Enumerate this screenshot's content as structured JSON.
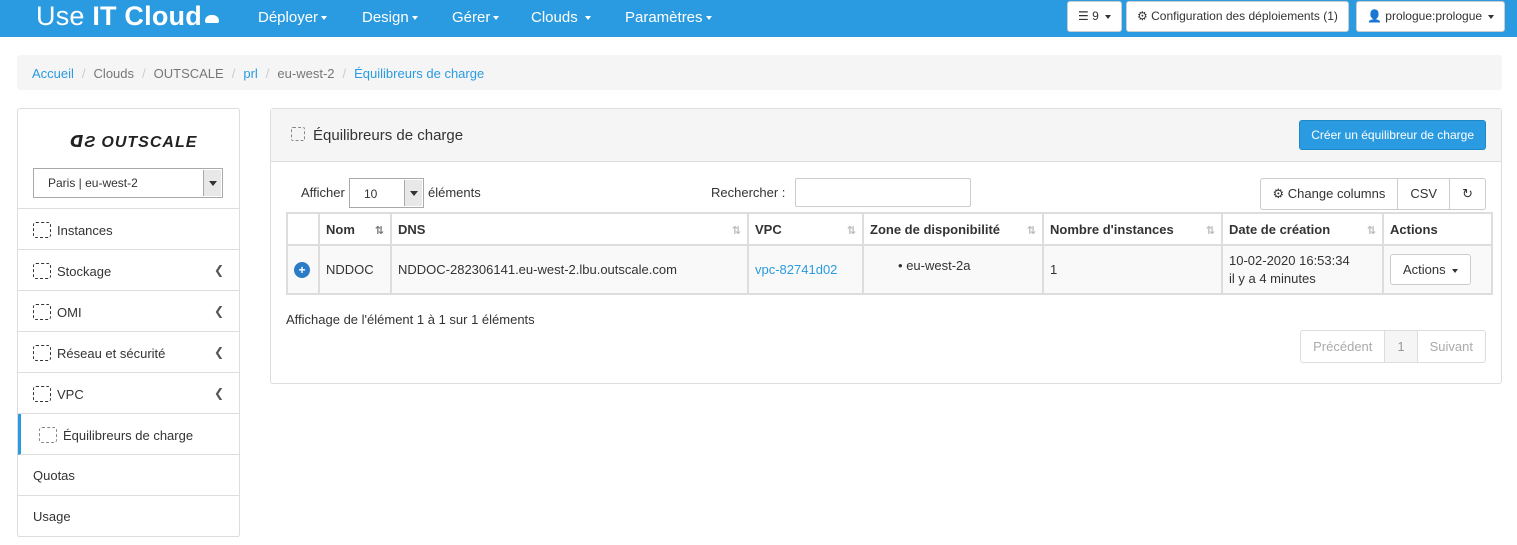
{
  "navbar": {
    "brand_use": "Use ",
    "brand_it": "IT Cloud",
    "menu": [
      {
        "label": "Déployer"
      },
      {
        "label": "Design"
      },
      {
        "label": "Gérer"
      },
      {
        "label": "Clouds"
      },
      {
        "label": "Paramètres"
      }
    ],
    "jobs_count": "9",
    "deploy_config": "Configuration des déploiements (1)",
    "user": "prologue:prologue"
  },
  "breadcrumb": {
    "items": [
      "Accueil",
      "Clouds",
      "OUTSCALE",
      "prl",
      "eu-west-2",
      "Équilibreurs de charge"
    ]
  },
  "sidebar": {
    "logo": "OUTSCALE",
    "region": "Paris | eu-west-2",
    "items": [
      {
        "label": "Instances"
      },
      {
        "label": "Stockage"
      },
      {
        "label": "OMI"
      },
      {
        "label": "Réseau et sécurité"
      },
      {
        "label": "VPC"
      },
      {
        "label": "Équilibreurs de charge"
      },
      {
        "label": "Quotas"
      },
      {
        "label": "Usage"
      }
    ]
  },
  "panel": {
    "title": "Équilibreurs de charge",
    "create_label": "Créer un équilibreur de charge",
    "show_label": "Afficher",
    "page_length": "10",
    "elements_label": "éléments",
    "search_label": "Rechercher :",
    "change_columns": "Change columns",
    "csv": "CSV",
    "columns": [
      "Nom",
      "DNS",
      "VPC",
      "Zone de disponibilité",
      "Nombre d'instances",
      "Date de création",
      "Actions"
    ],
    "rows": [
      {
        "nom": "NDDOC",
        "dns": "NDDOC-282306141.eu-west-2.lbu.outscale.com",
        "vpc": "vpc-82741d02",
        "zone": "eu-west-2a",
        "instances": "1",
        "date": "10-02-2020 16:53:34",
        "relative": "il y a 4 minutes",
        "actions": "Actions"
      }
    ],
    "info": "Affichage de l'élément 1 à 1 sur 1 éléments",
    "pager": {
      "prev": "Précédent",
      "page": "1",
      "next": "Suivant"
    }
  },
  "colors": {
    "accent": "#2a9be0"
  }
}
